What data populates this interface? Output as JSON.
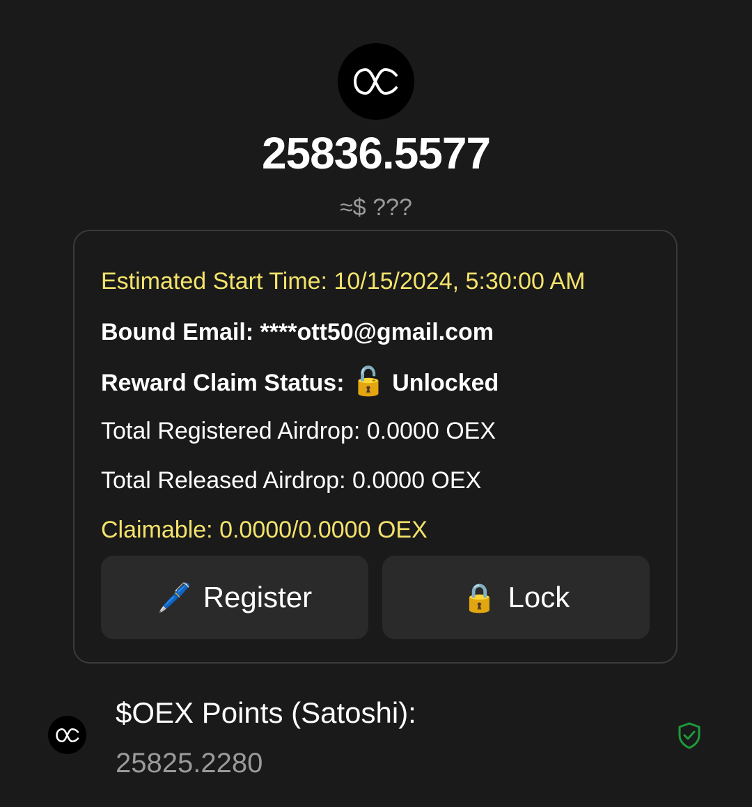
{
  "header": {
    "logo_icon": "oex-logo-icon",
    "balance": "25836.5577",
    "usd_value": "≈$ ???"
  },
  "card": {
    "estimated_start_time": "Estimated Start Time: 10/15/2024, 5:30:00 AM",
    "bound_email": "Bound Email: ****ott50@gmail.com",
    "reward_claim_status_label": "Reward Claim Status:",
    "reward_claim_status_icon": "🔓",
    "reward_claim_status_value": "Unlocked",
    "total_registered_airdrop": "Total Registered Airdrop: 0.0000 OEX",
    "total_released_airdrop": "Total Released Airdrop: 0.0000 OEX",
    "claimable": "Claimable: 0.0000/0.0000 OEX",
    "register_button": {
      "icon": "🖊️",
      "label": "Register"
    },
    "lock_button": {
      "icon": "🔒",
      "label": "Lock"
    }
  },
  "points": {
    "title": "$OEX Points (Satoshi):",
    "value": "25825.2280",
    "verified_icon": "shield-check-icon"
  },
  "colors": {
    "background": "#1a1a1a",
    "highlight_yellow": "#f4e36b",
    "muted_gray": "#9a9a9a",
    "button_bg": "#2a2a2a",
    "shield_green": "#1f9a3a"
  }
}
